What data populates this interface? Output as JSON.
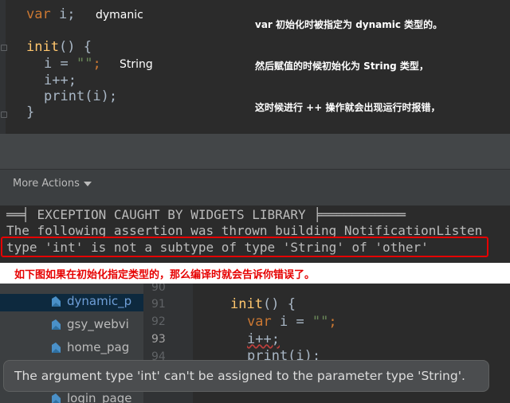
{
  "panel1": {
    "code": {
      "var_kw": "var",
      "var_name": "i;",
      "init_name": "init",
      "init_paren": "()",
      "open_brace": "{",
      "assign_left": "i = ",
      "assign_str": "\"\"",
      "assign_semi": ";",
      "increment": "i++;",
      "print_fn": "print",
      "print_args": "(i);",
      "close_brace": "}"
    },
    "type_labels": {
      "var_type": "dymanic",
      "assign_type": "String"
    },
    "notes": [
      "var 初始化时被指定为 dynamic 类型的。",
      "然后赋值的时候初始化为 String 类型，",
      "这时候进行 ++ 操作就会出现运行时报错，"
    ]
  },
  "toolbar": {
    "more_actions": "More Actions"
  },
  "console": {
    "lines": [
      "══╡ EXCEPTION CAUGHT BY WIDGETS LIBRARY ╞═══════════",
      "The following assertion was thrown building NotificationListen",
      "type 'int' is not a subtype of type 'String' of 'other'"
    ]
  },
  "caption": "如下图如果在初始化指定类型的，那么编译时就会告诉你错误了。",
  "panel4": {
    "tree_items": [
      "dynamic_p",
      "gsy_webvi",
      "home_pag",
      "login_page"
    ],
    "line_numbers": [
      "90",
      "91",
      "92",
      "93",
      "94"
    ],
    "code": {
      "init_name": "init",
      "init_paren": "()",
      "open_brace": "{",
      "var_kw": "var",
      "assign_left": "i = ",
      "assign_str": "\"\"",
      "assign_semi": ";",
      "increment": "i++;",
      "print_call": "print(i);"
    }
  },
  "tooltip": {
    "text": "The argument type 'int' can't be assigned to the parameter type 'String'."
  },
  "colors": {
    "keyword": "#cc7832",
    "function": "#ffc66d",
    "string": "#6a8759",
    "plain": "#a9b7c6",
    "error_red": "#e60000",
    "editor_bg": "#2b2b2b"
  }
}
